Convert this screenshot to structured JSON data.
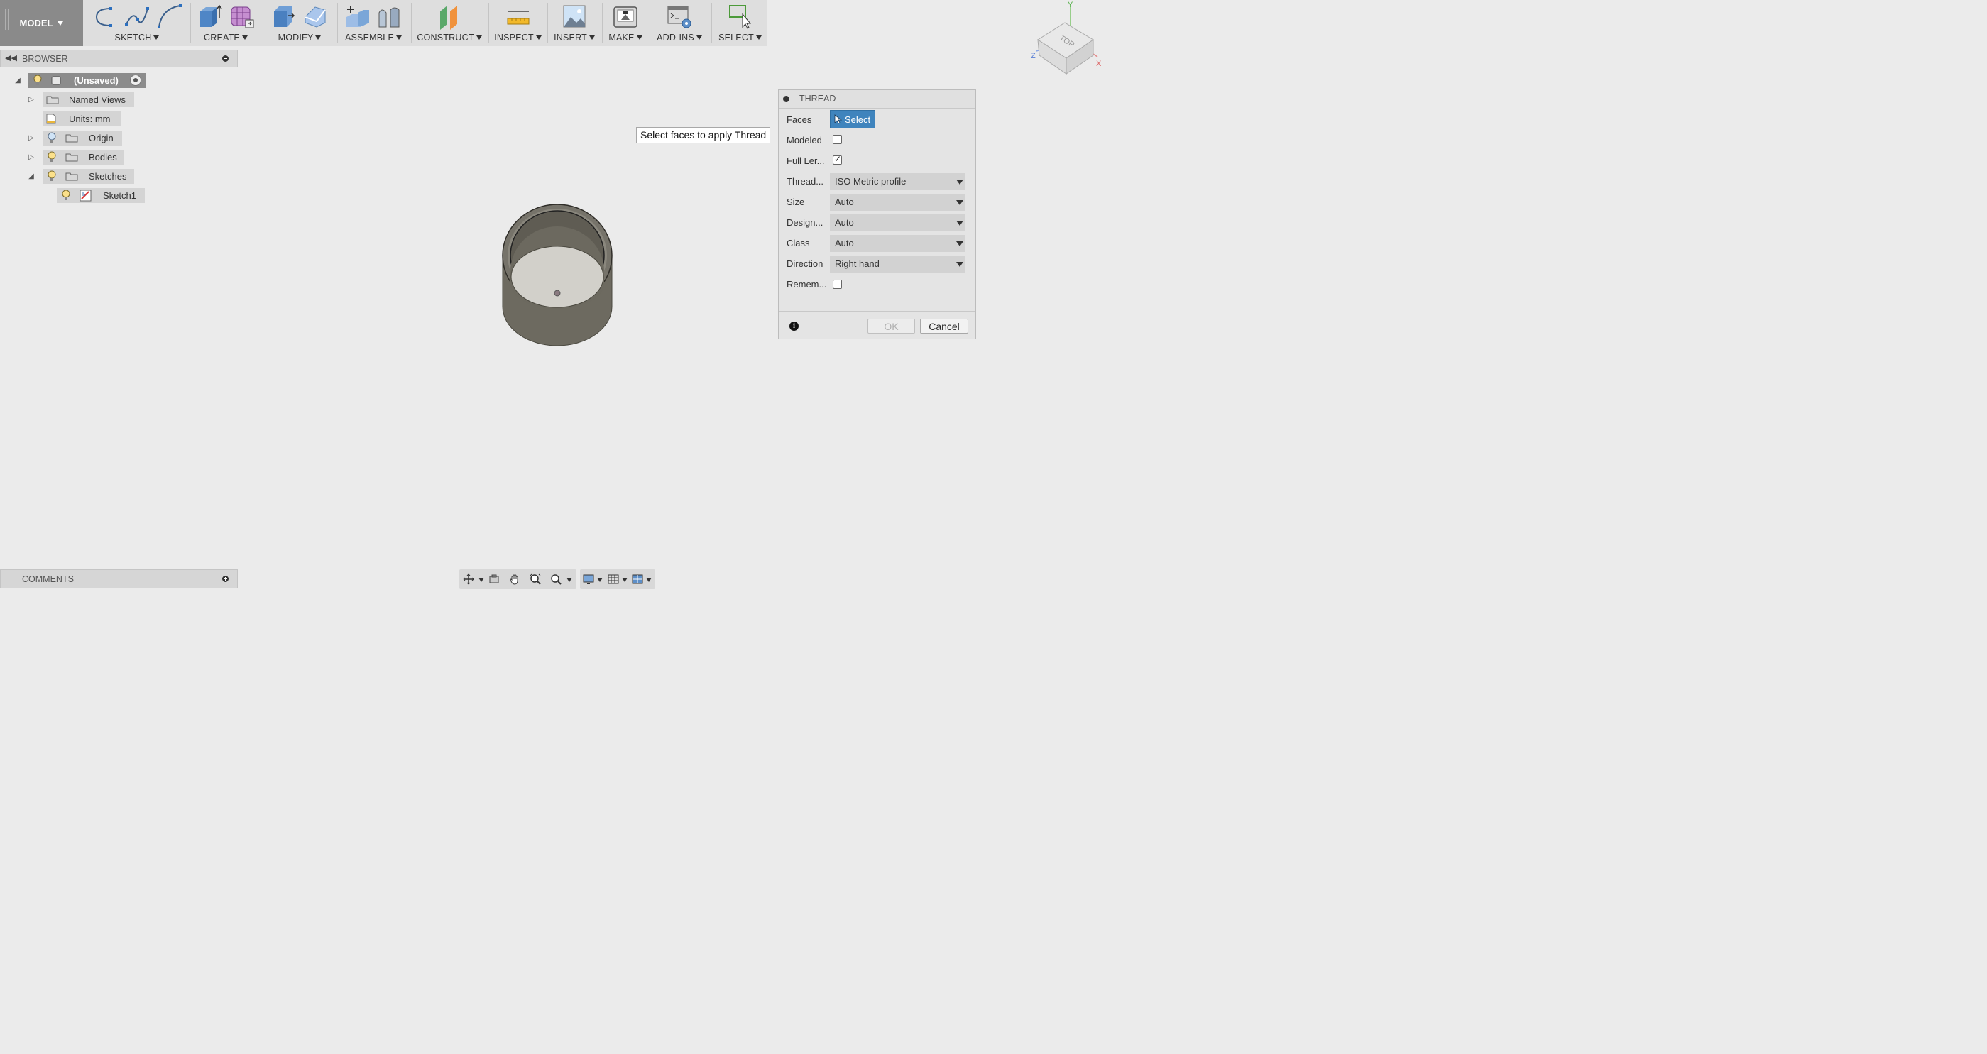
{
  "toolbar": {
    "workspace": "MODEL",
    "groups": {
      "sketch": "SKETCH",
      "create": "CREATE",
      "modify": "MODIFY",
      "assemble": "ASSEMBLE",
      "construct": "CONSTRUCT",
      "inspect": "INSPECT",
      "insert": "INSERT",
      "make": "MAKE",
      "addins": "ADD-INS",
      "select": "SELECT"
    }
  },
  "browser": {
    "title": "BROWSER",
    "root": "(Unsaved)",
    "items": [
      {
        "label": "Named Views"
      },
      {
        "label": "Units: mm"
      },
      {
        "label": "Origin"
      },
      {
        "label": "Bodies"
      },
      {
        "label": "Sketches"
      },
      {
        "label": "Sketch1"
      }
    ]
  },
  "viewcube": {
    "face": "TOP",
    "axes": {
      "x": "X",
      "y": "Y",
      "z": "Z"
    }
  },
  "tooltip": "Select faces to apply Thread",
  "thread_dialog": {
    "title": "THREAD",
    "faces_label": "Faces",
    "faces_button": "Select",
    "modeled_label": "Modeled",
    "modeled_checked": false,
    "full_length_label": "Full Ler...",
    "full_length_checked": true,
    "thread_type_label": "Thread...",
    "thread_type_value": "ISO Metric profile",
    "size_label": "Size",
    "size_value": "Auto",
    "designation_label": "Design...",
    "designation_value": "Auto",
    "class_label": "Class",
    "class_value": "Auto",
    "direction_label": "Direction",
    "direction_value": "Right hand",
    "remember_label": "Remem...",
    "remember_checked": false,
    "ok": "OK",
    "cancel": "Cancel"
  },
  "comments": {
    "title": "COMMENTS"
  },
  "colors": {
    "accent": "#3f84bd",
    "toolbar_bg": "#dedede",
    "workspace_bg": "#8a8a8a",
    "canvas_bg": "#ebebeb"
  }
}
